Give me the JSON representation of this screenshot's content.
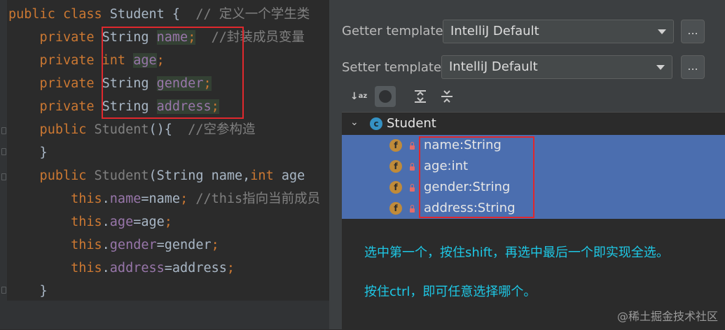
{
  "editor": {
    "lines": [
      {
        "parts": [
          {
            "t": "public class ",
            "c": "kw"
          },
          {
            "t": "Student ",
            "c": "cls"
          },
          {
            "t": "{  ",
            "c": ""
          },
          {
            "t": "// 定义一个学生类",
            "c": "cmt"
          }
        ]
      },
      {
        "parts": [
          {
            "t": "    private ",
            "c": "kw"
          },
          {
            "t": "String ",
            "c": ""
          },
          {
            "t": "name",
            "c": "fld hl"
          },
          {
            "t": ";",
            "c": "kw hl"
          },
          {
            "t": "  //封装成员变量",
            "c": "cmt"
          }
        ]
      },
      {
        "parts": [
          {
            "t": "    private ",
            "c": "kw"
          },
          {
            "t": "int ",
            "c": "kw"
          },
          {
            "t": "age",
            "c": "fld hl"
          },
          {
            "t": ";",
            "c": "kw"
          }
        ]
      },
      {
        "parts": [
          {
            "t": "    private ",
            "c": "kw"
          },
          {
            "t": "String ",
            "c": ""
          },
          {
            "t": "gender",
            "c": "fld hl"
          },
          {
            "t": ";",
            "c": "kw hl"
          }
        ]
      },
      {
        "parts": [
          {
            "t": "    private ",
            "c": "kw"
          },
          {
            "t": "String ",
            "c": ""
          },
          {
            "t": "address",
            "c": "fld hl"
          },
          {
            "t": ";",
            "c": "kw hl"
          }
        ]
      },
      {
        "parts": [
          {
            "t": "    public ",
            "c": "kw"
          },
          {
            "t": "Student",
            "c": "cmt"
          },
          {
            "t": "(){  ",
            "c": ""
          },
          {
            "t": "//空参构造",
            "c": "cmt"
          }
        ]
      },
      {
        "parts": [
          {
            "t": "    }",
            "c": ""
          }
        ]
      },
      {
        "parts": [
          {
            "t": "    public ",
            "c": "kw"
          },
          {
            "t": "Student",
            "c": "cmt"
          },
          {
            "t": "(String name,",
            "c": ""
          },
          {
            "t": "int ",
            "c": "kw"
          },
          {
            "t": "age",
            "c": ""
          }
        ]
      },
      {
        "parts": [
          {
            "t": "        this",
            "c": "kw"
          },
          {
            "t": ".",
            "c": ""
          },
          {
            "t": "name",
            "c": "fld"
          },
          {
            "t": "=name",
            "c": ""
          },
          {
            "t": "; ",
            "c": "kw"
          },
          {
            "t": "//this指向当前成员",
            "c": "cmt"
          }
        ]
      },
      {
        "parts": [
          {
            "t": "        this",
            "c": "kw"
          },
          {
            "t": ".",
            "c": ""
          },
          {
            "t": "age",
            "c": "fld"
          },
          {
            "t": "=age",
            "c": ""
          },
          {
            "t": ";",
            "c": "kw"
          }
        ]
      },
      {
        "parts": [
          {
            "t": "        this",
            "c": "kw"
          },
          {
            "t": ".",
            "c": ""
          },
          {
            "t": "gender",
            "c": "fld"
          },
          {
            "t": "=gender",
            "c": ""
          },
          {
            "t": ";",
            "c": "kw"
          }
        ]
      },
      {
        "parts": [
          {
            "t": "        this",
            "c": "kw"
          },
          {
            "t": ".",
            "c": ""
          },
          {
            "t": "address",
            "c": "fld"
          },
          {
            "t": "=address",
            "c": ""
          },
          {
            "t": ";",
            "c": "kw"
          }
        ]
      },
      {
        "parts": [
          {
            "t": "    }",
            "c": ""
          }
        ]
      }
    ]
  },
  "dialog": {
    "getter_label": "Getter template:",
    "getter_value": "IntelliJ Default",
    "setter_label": "Setter template:",
    "setter_value": "IntelliJ Default",
    "dots": "...",
    "toolbar_icons": [
      "sort-alpha-icon",
      "circle-icon",
      "expand-all-icon",
      "collapse-all-icon"
    ],
    "tree": {
      "root": "Student",
      "fields": [
        "name:String",
        "age:int",
        "gender:String",
        "address:String"
      ]
    },
    "note1": "选中第一个，按住shift，再选中最后一个即实现全选。",
    "note2": "按住ctrl，即可任意选择哪个。"
  },
  "watermark": "@稀土掘金技术社区",
  "colors": {
    "selection": "#4b6eaf",
    "annotation": "#e0282d",
    "note": "#1ec8e6"
  }
}
